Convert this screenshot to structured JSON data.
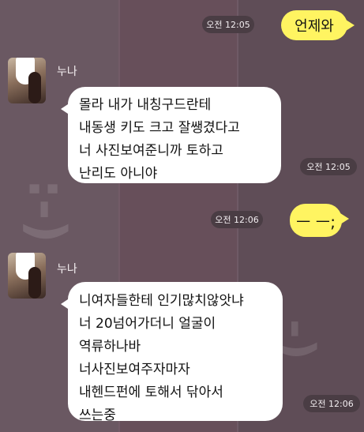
{
  "messages": [
    {
      "id": "m1",
      "side": "right",
      "text_lines": [
        "언제와"
      ],
      "time": "오전 12:05"
    },
    {
      "id": "m2",
      "side": "left",
      "sender": "누나",
      "text_lines": [
        "몰라 내가 내칭구드란테",
        "내동생 키도 크고 잘쌩겼다고",
        "너 사진보여준니까 토하고",
        "난리도 아니야"
      ],
      "time": "오전 12:05"
    },
    {
      "id": "m3",
      "side": "right",
      "text_lines": [
        "ㅡ ㅡ;"
      ],
      "time": "오전 12:06"
    },
    {
      "id": "m4",
      "side": "left",
      "sender": "누나",
      "text_lines": [
        "니여자들한테 인기많치않앗냐",
        "너 20넘어가더니 얼굴이",
        "역류하나바",
        "너사진보여주자마자",
        "내헨드펀에 토해서 닦아서",
        "쓰는중"
      ],
      "time": "오전 12:06"
    }
  ],
  "colors": {
    "background": "#5e5058",
    "my_bubble": "#fff461",
    "their_bubble": "#ffffff",
    "time_pill": "#4a3d44"
  },
  "decorations": {
    "emoticon_left": ":-)",
    "emoticon_right": "-)"
  }
}
